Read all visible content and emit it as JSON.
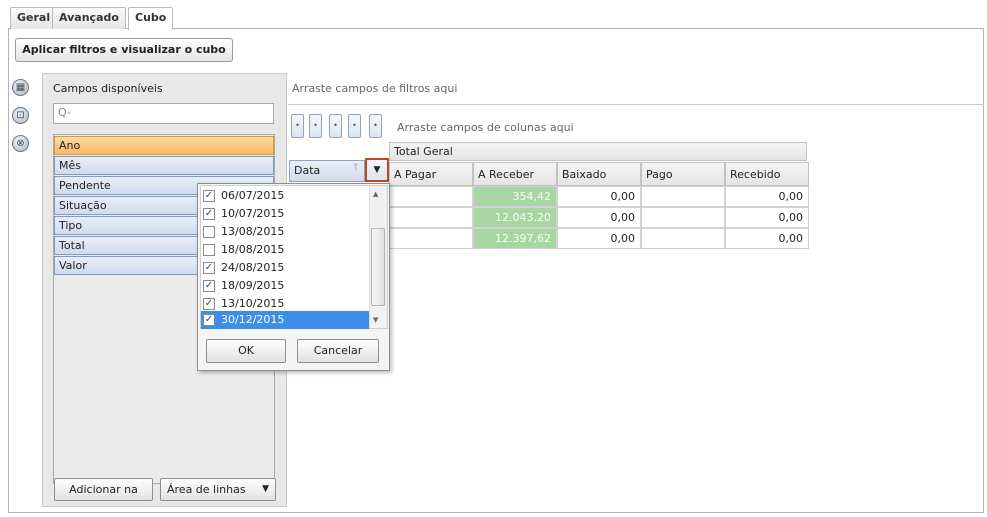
{
  "tabs": [
    {
      "label": "Geral"
    },
    {
      "label": "Avançado"
    },
    {
      "label": "Cubo"
    }
  ],
  "apply_button": "Aplicar filtros e visualizar o cubo",
  "field_list": {
    "title": "Campos disponíveis",
    "search_placeholder": "Q-",
    "fields": [
      "Ano",
      "Mês",
      "Pendente",
      "Situação",
      "Tipo",
      "Total",
      "Valor"
    ],
    "selected": "Ano",
    "add_button": "Adicionar na",
    "area_select": "Área de linhas"
  },
  "pivot": {
    "filter_zone": "Arraste campos de filtros aqui",
    "column_zone": "Arraste campos de colunas aqui",
    "grand_total": "Total Geral",
    "row_field": "Data",
    "columns": [
      "A Pagar",
      "A Receber",
      "Baixado",
      "Pago",
      "Recebido"
    ],
    "rows": [
      [
        "",
        "354,42",
        "0,00",
        "",
        "0,00"
      ],
      [
        "",
        "12.043,20",
        "0,00",
        "",
        "0,00"
      ],
      [
        "",
        "12.397,62",
        "0,00",
        "",
        "0,00"
      ]
    ]
  },
  "filter_popup": {
    "items": [
      {
        "label": "06/07/2015",
        "checked": true
      },
      {
        "label": "10/07/2015",
        "checked": true
      },
      {
        "label": "13/08/2015",
        "checked": false
      },
      {
        "label": "18/08/2015",
        "checked": false
      },
      {
        "label": "24/08/2015",
        "checked": true
      },
      {
        "label": "18/09/2015",
        "checked": true
      },
      {
        "label": "13/10/2015",
        "checked": true
      },
      {
        "label": "30/12/2015",
        "checked": true
      }
    ],
    "ok": "OK",
    "cancel": "Cancelar"
  },
  "colors": {
    "highlight": "#3d8ee8",
    "selected_field": "#f7b865",
    "green_cell": "#a8d6a2",
    "dropdown_border": "#c0471f"
  }
}
